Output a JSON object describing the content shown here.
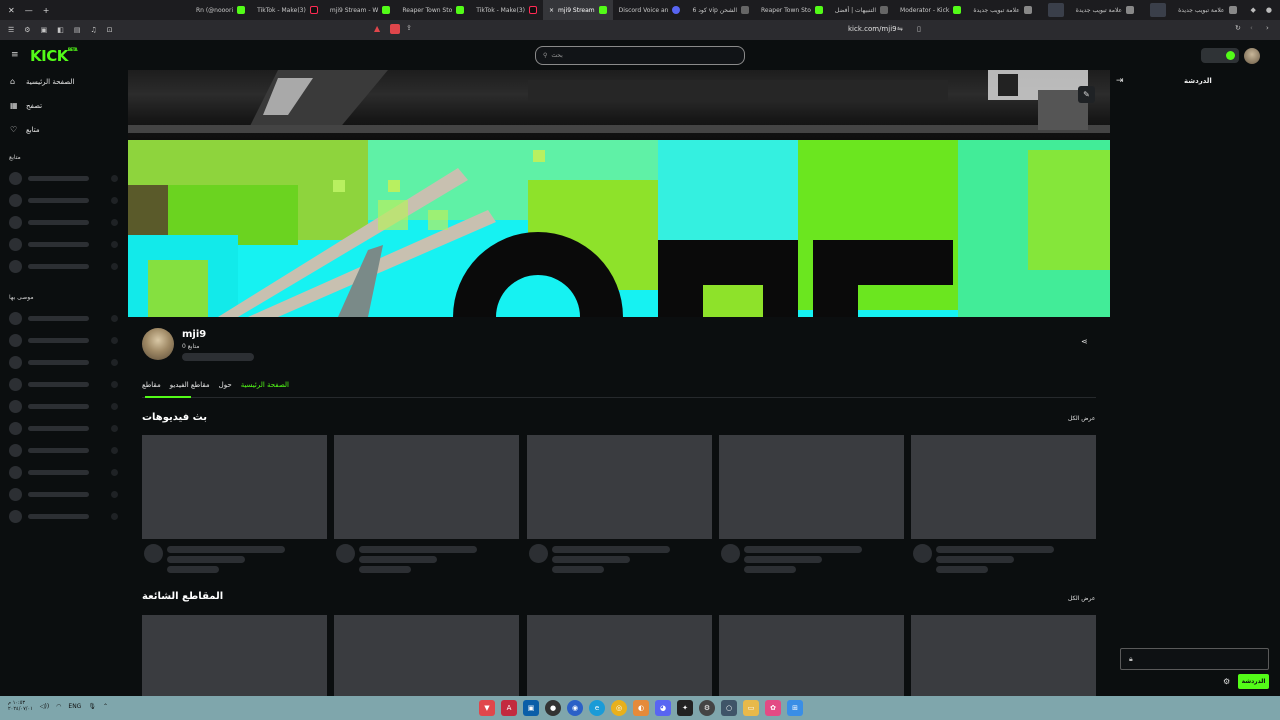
{
  "browser": {
    "tabs": [
      {
        "title": "علامة تبويب جديدة",
        "icon": "newtab-icon",
        "active": false
      },
      {
        "title": "",
        "icon": "thumbnail",
        "active": false,
        "thumb": true
      },
      {
        "title": "علامة تبويب جديدة",
        "icon": "newtab-icon",
        "active": false
      },
      {
        "title": "",
        "icon": "thumbnail",
        "active": false,
        "thumb": true
      },
      {
        "title": "علامة تبويب جديدة",
        "icon": "newtab-icon",
        "active": false
      },
      {
        "title": "Moderator - Kick",
        "icon": "kick-icon",
        "active": false
      },
      {
        "title": "التنبيهات | أفضل",
        "icon": "ghost-icon",
        "active": false
      },
      {
        "title": "Reaper Town Sto",
        "icon": "kick-icon",
        "active": false
      },
      {
        "title": "الشحن vip كود 6",
        "icon": "ghost-icon",
        "active": false
      },
      {
        "title": "Discord Voice an",
        "icon": "discord-icon",
        "active": false
      },
      {
        "title": "mji9 Stream",
        "icon": "kick-icon",
        "active": true
      },
      {
        "title": "(3)TikTok - Make",
        "icon": "tiktok-icon",
        "active": false
      },
      {
        "title": "Reaper Town Sto",
        "icon": "kick-icon",
        "active": false
      },
      {
        "title": "mji9 Stream - W",
        "icon": "kick-icon",
        "active": false
      },
      {
        "title": "(3)TikTok - Make",
        "icon": "tiktok-icon",
        "active": false
      },
      {
        "title": "Rn (@nooori",
        "icon": "kick-icon",
        "active": false
      }
    ],
    "url": "kick.com/mji9"
  },
  "topbar": {
    "logo": "KICK",
    "logo_sup": "BETA",
    "search_placeholder": "بحث"
  },
  "sidebar": {
    "nav": [
      {
        "label": "الصفحة الرئيسية",
        "icon": "home-icon"
      },
      {
        "label": "تصفح",
        "icon": "browse-icon"
      },
      {
        "label": "متابع",
        "icon": "heart-icon"
      }
    ],
    "following_title": "متابع",
    "recommended_title": "موصى بها"
  },
  "channel": {
    "name": "mji9",
    "followers": "0 متابع",
    "tabs": [
      {
        "label": "الصفحة الرئيسية",
        "active": true
      },
      {
        "label": "حول",
        "active": false
      },
      {
        "label": "مقاطع الفيديو",
        "active": false
      },
      {
        "label": "مقاطع",
        "active": false
      }
    ]
  },
  "sections": {
    "vods_title": "بث فيديوهات",
    "clips_title": "المقاطع الشائعة",
    "see_all": "عرض الكل"
  },
  "chat": {
    "title": "الدردشة",
    "send_label": "الدردشة"
  },
  "taskbar": {
    "time": "١٠:٥٣ م",
    "date": "٢٠٢٤/٠٧/٠١",
    "lang": "ENG"
  },
  "colors": {
    "accent": "#53fc18",
    "background": "#0b0e0f",
    "skeleton": "#2c2f33",
    "card": "#3a3c40",
    "taskbar": "#7fa6ac"
  }
}
